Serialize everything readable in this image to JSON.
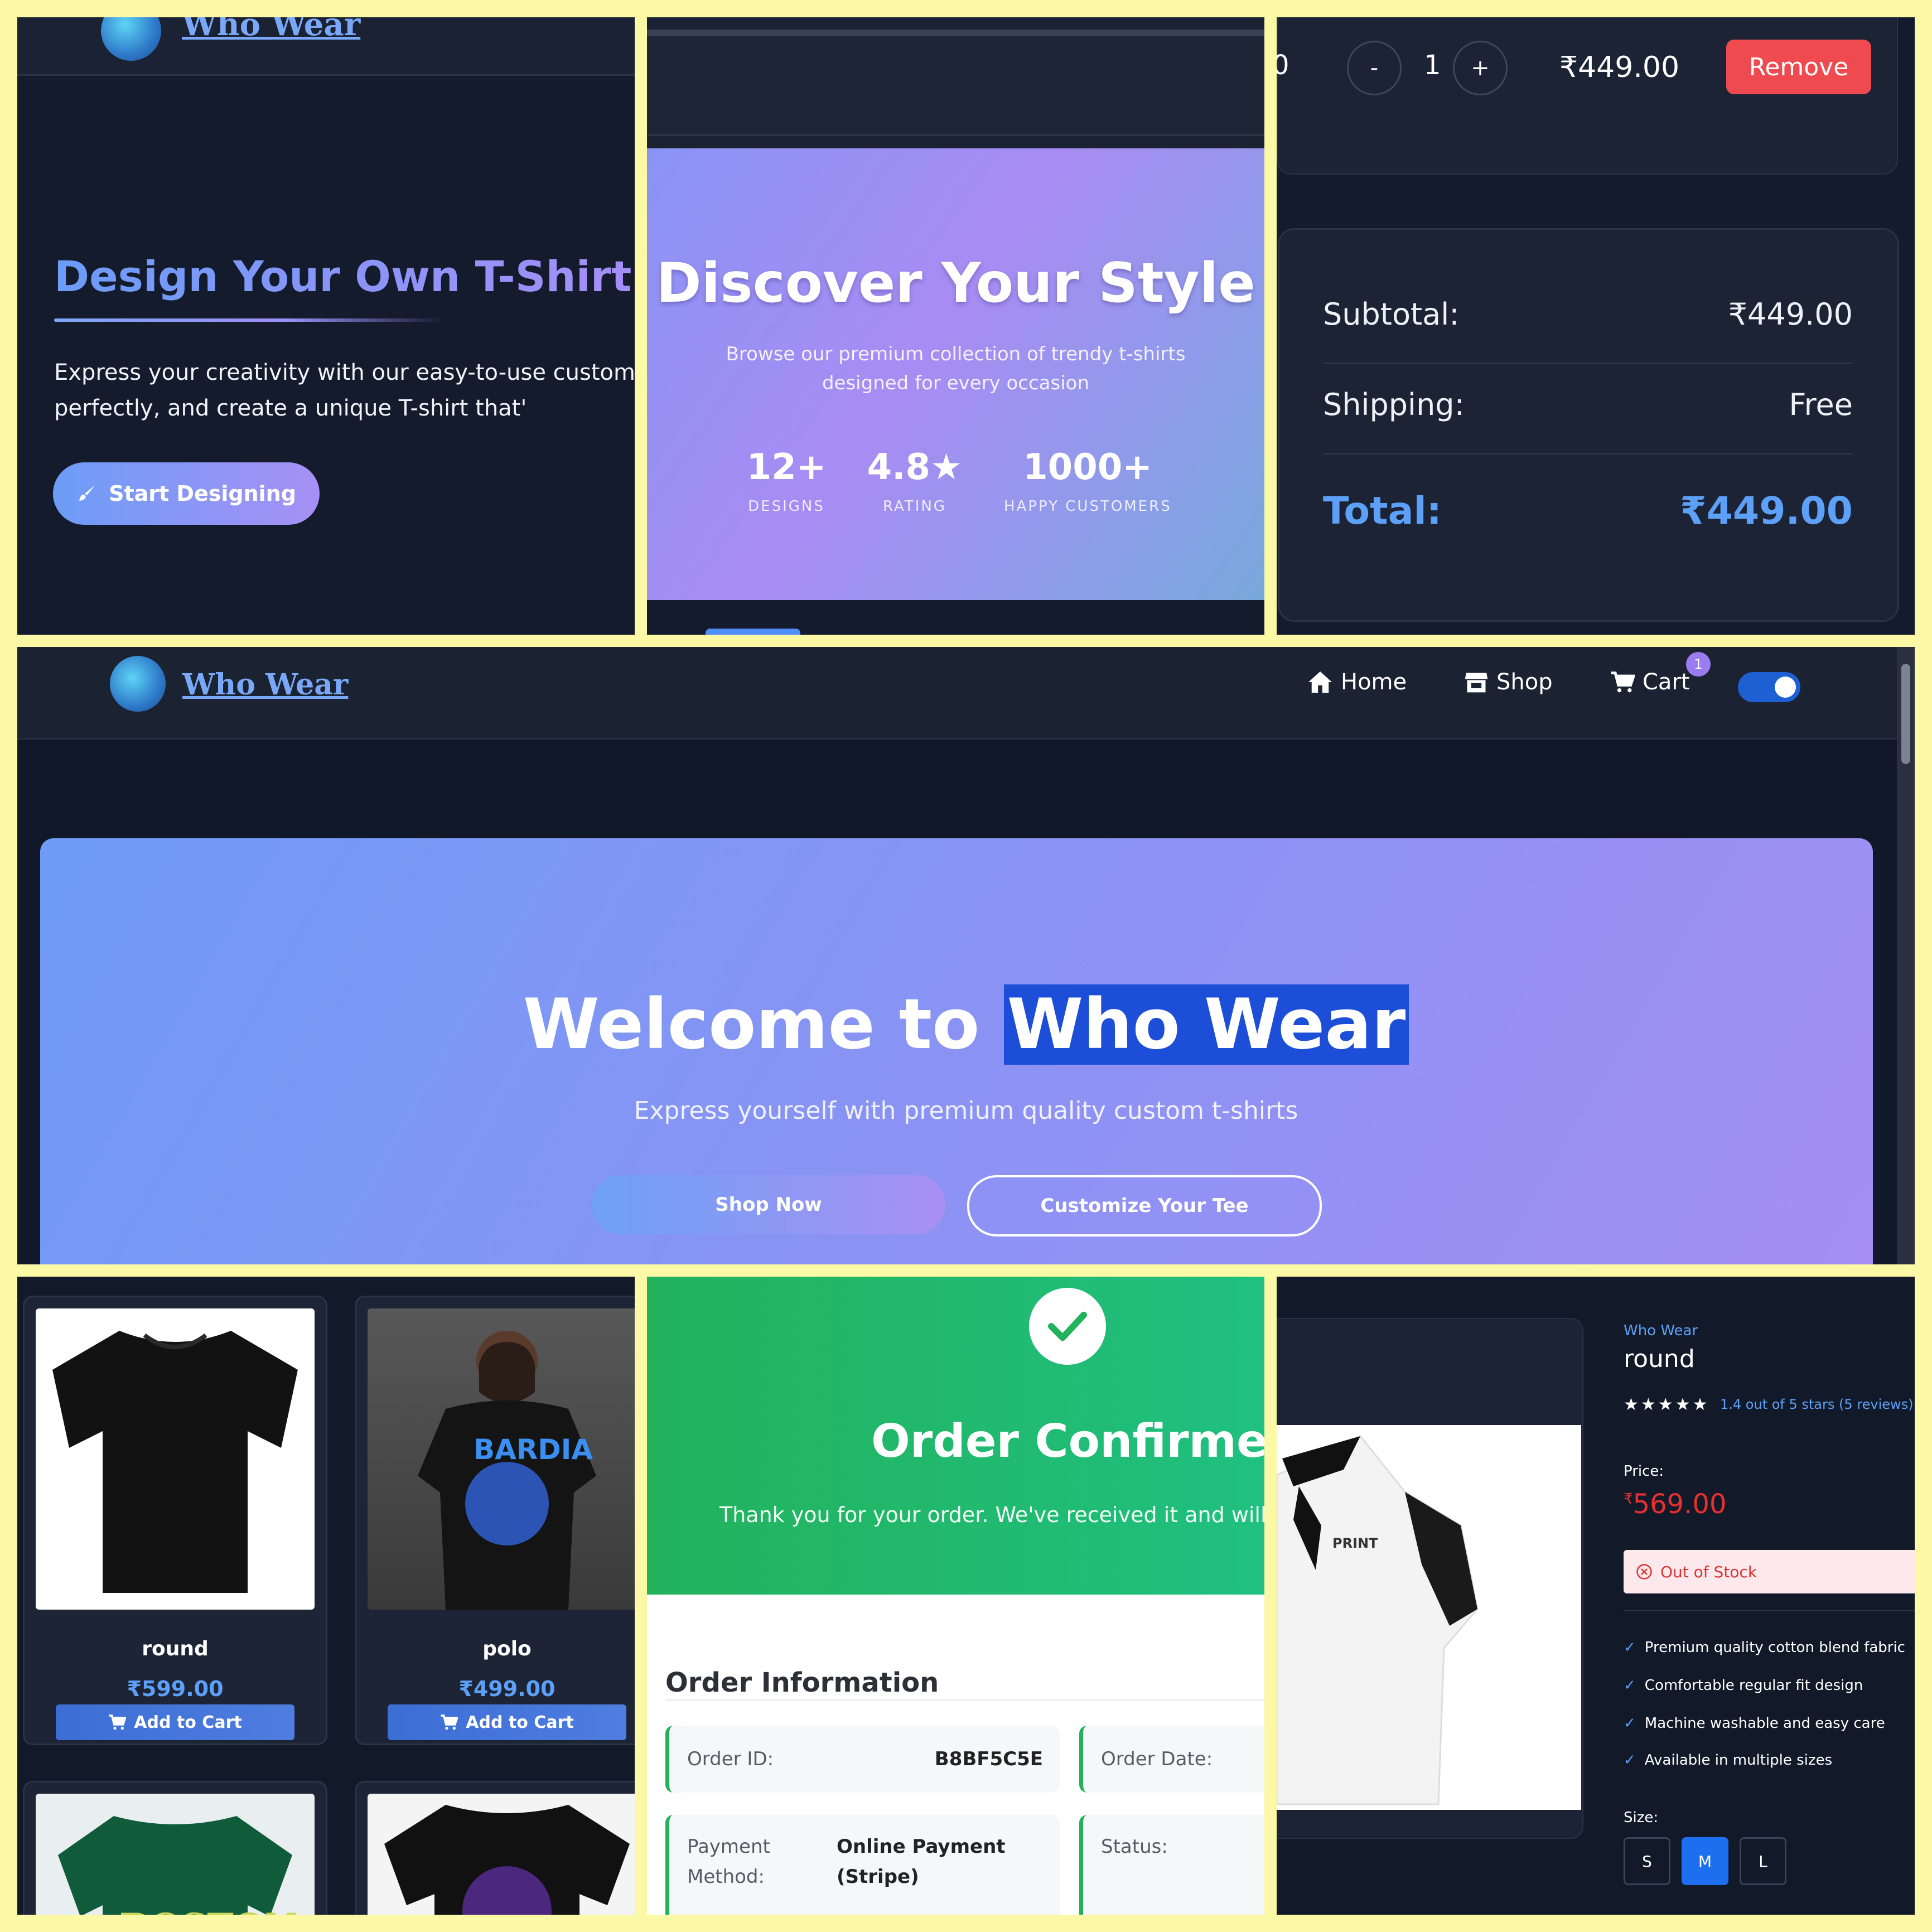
{
  "brand": "Who Wear",
  "design_panel": {
    "heading": "Design Your Own T-Shirt",
    "body": "Express your creativity with our easy-to-use customi position it perfectly, and create a unique T-shirt that'",
    "button": "Start Designing"
  },
  "discover_panel": {
    "heading": "Discover Your Style",
    "subheading": "Browse our premium collection of trendy t-shirts designed for every occasion",
    "stats": [
      {
        "value": "12+",
        "label": "DESIGNS"
      },
      {
        "value": "4.8★",
        "label": "RATING"
      },
      {
        "value": "1000+",
        "label": "HAPPY CUSTOMERS"
      }
    ]
  },
  "cart_panel": {
    "partial_digit": "0",
    "minus": "-",
    "quantity": "1",
    "plus": "+",
    "line_price": "₹449.00",
    "remove": "Remove",
    "subtotal_label": "Subtotal:",
    "subtotal_value": "₹449.00",
    "shipping_label": "Shipping:",
    "shipping_value": "Free",
    "total_label": "Total:",
    "total_value": "₹449.00"
  },
  "home": {
    "nav": {
      "home": "Home",
      "shop": "Shop",
      "cart": "Cart",
      "cart_badge": "1"
    },
    "hero_title_prefix": "Welcome to ",
    "hero_title_selected": "Who Wear",
    "hero_subtitle": "Express yourself with premium quality custom t-shirts",
    "shop_now": "Shop Now",
    "customize": "Customize Your Tee"
  },
  "products": [
    {
      "name": "round",
      "price": "₹599.00",
      "add": "Add to Cart"
    },
    {
      "name": "polo",
      "price": "₹499.00",
      "add": "Add to Cart"
    }
  ],
  "order": {
    "title": "Order Confirmed!",
    "message": "Thank you for your order. We've received it and will pr",
    "section": "Order Information",
    "order_id_label": "Order ID:",
    "order_id": "B8BF5C5E",
    "order_date_label": "Order Date:",
    "payment_label_1": "Payment",
    "payment_label_2": "Method:",
    "payment_value_1": "Online Payment",
    "payment_value_2": "(Stripe)",
    "status_label": "Status:"
  },
  "detail": {
    "brand": "Who Wear",
    "title": "round",
    "stars": "★★★★★",
    "rating_text": "1.4 out of 5 stars (5 reviews)",
    "price_label": "Price:",
    "price": "569.00",
    "stock": "Out of Stock",
    "features": [
      "Premium quality cotton blend fabric",
      "Comfortable regular fit design",
      "Machine washable and easy care",
      "Available in multiple sizes"
    ],
    "size_label": "Size:",
    "sizes": [
      "S",
      "M",
      "L"
    ],
    "selected_size": "M"
  }
}
